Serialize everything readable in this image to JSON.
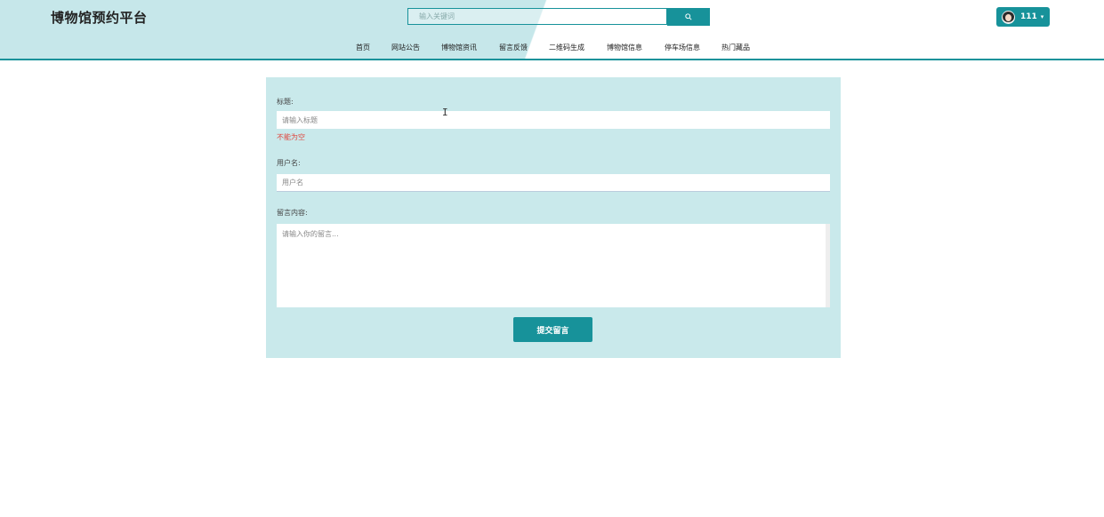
{
  "header": {
    "site_title": "博物馆预约平台",
    "search_placeholder": "输入关键词",
    "search_icon": "search-icon",
    "user_name": "111",
    "user_caret": "▾",
    "accent_color": "#17929a"
  },
  "nav": {
    "items": [
      {
        "label": "首页"
      },
      {
        "label": "网站公告"
      },
      {
        "label": "博物馆资讯"
      },
      {
        "label": "留言反馈"
      },
      {
        "label": "二维码生成"
      },
      {
        "label": "博物馆信息"
      },
      {
        "label": "停车场信息"
      },
      {
        "label": "热门藏品"
      }
    ]
  },
  "form": {
    "title_label": "标题:",
    "title_placeholder": "请输入标题",
    "title_value": "",
    "title_error": "不能为空",
    "username_label": "用户名:",
    "username_placeholder": "用户名",
    "username_value": "",
    "content_label": "留言内容:",
    "content_placeholder": "请输入你的留言...",
    "submit_label": "提交留言"
  }
}
